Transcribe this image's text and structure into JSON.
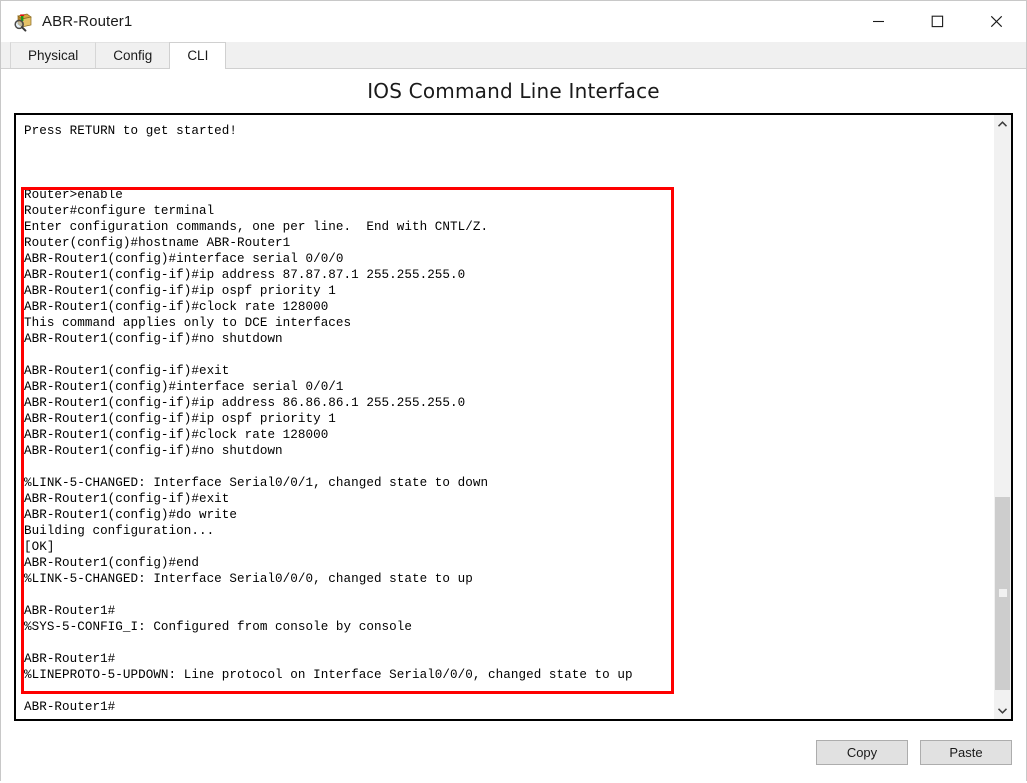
{
  "window": {
    "title": "ABR-Router1",
    "icon": "packet-tracer-device-icon",
    "controls": {
      "minimize": "minimize-icon",
      "maximize": "maximize-icon",
      "close": "close-icon"
    }
  },
  "tabs": [
    {
      "label": "Physical",
      "active": false
    },
    {
      "label": "Config",
      "active": false
    },
    {
      "label": "CLI",
      "active": true
    }
  ],
  "panel": {
    "title": "IOS Command Line Interface"
  },
  "terminal": {
    "content": "Press RETURN to get started!\n\n\n\nRouter>enable\nRouter#configure terminal\nEnter configuration commands, one per line.  End with CNTL/Z.\nRouter(config)#hostname ABR-Router1\nABR-Router1(config)#interface serial 0/0/0\nABR-Router1(config-if)#ip address 87.87.87.1 255.255.255.0\nABR-Router1(config-if)#ip ospf priority 1\nABR-Router1(config-if)#clock rate 128000\nThis command applies only to DCE interfaces\nABR-Router1(config-if)#no shutdown\n\nABR-Router1(config-if)#exit\nABR-Router1(config)#interface serial 0/0/1\nABR-Router1(config-if)#ip address 86.86.86.1 255.255.255.0\nABR-Router1(config-if)#ip ospf priority 1\nABR-Router1(config-if)#clock rate 128000\nABR-Router1(config-if)#no shutdown\n\n%LINK-5-CHANGED: Interface Serial0/0/1, changed state to down\nABR-Router1(config-if)#exit\nABR-Router1(config)#do write\nBuilding configuration...\n[OK]\nABR-Router1(config)#end\n%LINK-5-CHANGED: Interface Serial0/0/0, changed state to up\n\nABR-Router1#\n%SYS-5-CONFIG_I: Configured from console by console\n\nABR-Router1#\n%LINEPROTO-5-UPDOWN: Line protocol on Interface Serial0/0/0, changed state to up\n\nABR-Router1#",
    "highlight_color": "#fe0000",
    "scrollbar": {
      "up_arrow": "chevron-up-icon",
      "down_arrow": "chevron-down-icon"
    }
  },
  "footer": {
    "copy_label": "Copy",
    "paste_label": "Paste"
  }
}
